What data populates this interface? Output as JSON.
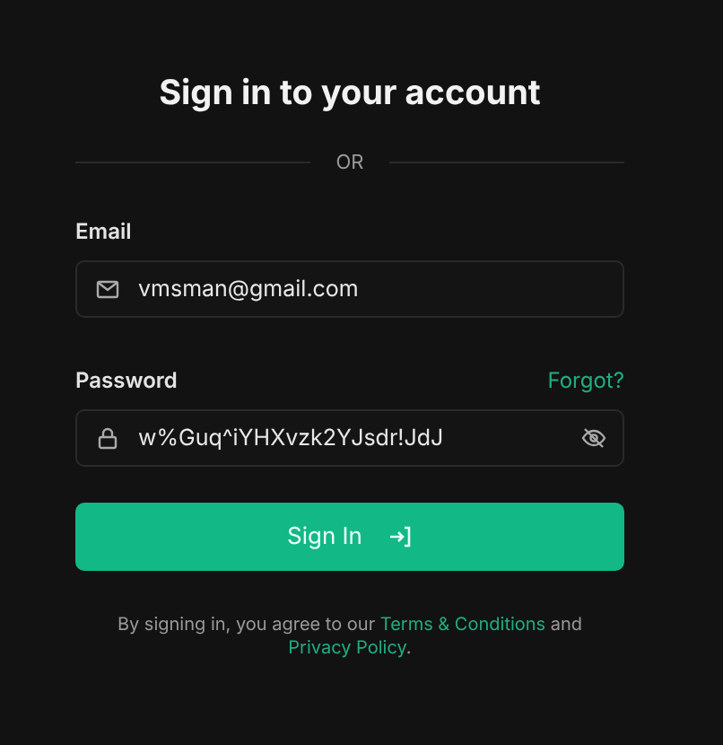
{
  "title": "Sign in to your account",
  "divider_label": "OR",
  "email": {
    "label": "Email",
    "value": "vmsman@gmail.com"
  },
  "password": {
    "label": "Password",
    "forgot_link": "Forgot?",
    "value": "w%Guq^iYHXvzk2YJsdr!JdJ"
  },
  "submit_button": "Sign In",
  "legal": [
    {
      "kind": "text",
      "text": "By signing in, you agree to our "
    },
    {
      "kind": "link",
      "text": "Terms & Conditions"
    },
    {
      "kind": "text",
      "text": " and "
    },
    {
      "kind": "link",
      "text": "Privacy Policy"
    },
    {
      "kind": "text",
      "text": "."
    }
  ]
}
